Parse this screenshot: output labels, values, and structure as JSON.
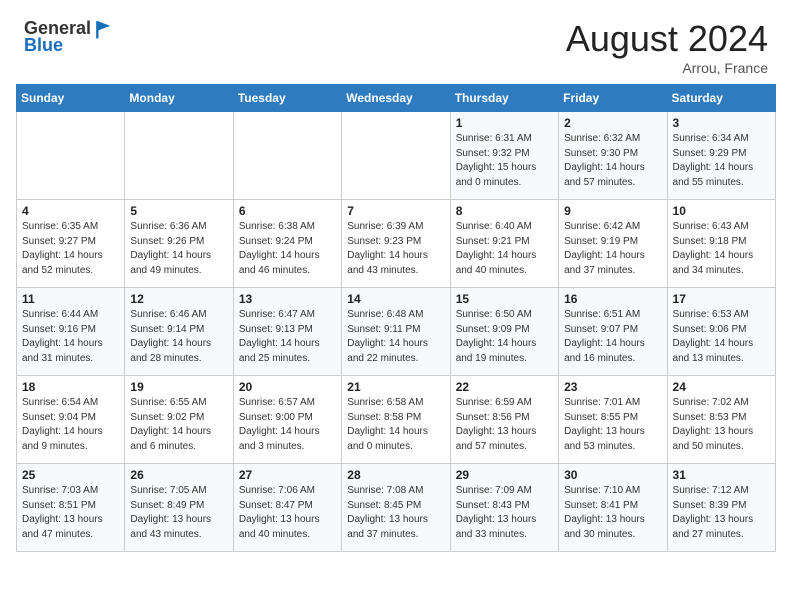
{
  "header": {
    "logo_line1": "General",
    "logo_line2": "Blue",
    "month_title": "August 2024",
    "location": "Arrou, France"
  },
  "days_of_week": [
    "Sunday",
    "Monday",
    "Tuesday",
    "Wednesday",
    "Thursday",
    "Friday",
    "Saturday"
  ],
  "weeks": [
    [
      {
        "day": "",
        "info": ""
      },
      {
        "day": "",
        "info": ""
      },
      {
        "day": "",
        "info": ""
      },
      {
        "day": "",
        "info": ""
      },
      {
        "day": "1",
        "info": "Sunrise: 6:31 AM\nSunset: 9:32 PM\nDaylight: 15 hours\nand 0 minutes."
      },
      {
        "day": "2",
        "info": "Sunrise: 6:32 AM\nSunset: 9:30 PM\nDaylight: 14 hours\nand 57 minutes."
      },
      {
        "day": "3",
        "info": "Sunrise: 6:34 AM\nSunset: 9:29 PM\nDaylight: 14 hours\nand 55 minutes."
      }
    ],
    [
      {
        "day": "4",
        "info": "Sunrise: 6:35 AM\nSunset: 9:27 PM\nDaylight: 14 hours\nand 52 minutes."
      },
      {
        "day": "5",
        "info": "Sunrise: 6:36 AM\nSunset: 9:26 PM\nDaylight: 14 hours\nand 49 minutes."
      },
      {
        "day": "6",
        "info": "Sunrise: 6:38 AM\nSunset: 9:24 PM\nDaylight: 14 hours\nand 46 minutes."
      },
      {
        "day": "7",
        "info": "Sunrise: 6:39 AM\nSunset: 9:23 PM\nDaylight: 14 hours\nand 43 minutes."
      },
      {
        "day": "8",
        "info": "Sunrise: 6:40 AM\nSunset: 9:21 PM\nDaylight: 14 hours\nand 40 minutes."
      },
      {
        "day": "9",
        "info": "Sunrise: 6:42 AM\nSunset: 9:19 PM\nDaylight: 14 hours\nand 37 minutes."
      },
      {
        "day": "10",
        "info": "Sunrise: 6:43 AM\nSunset: 9:18 PM\nDaylight: 14 hours\nand 34 minutes."
      }
    ],
    [
      {
        "day": "11",
        "info": "Sunrise: 6:44 AM\nSunset: 9:16 PM\nDaylight: 14 hours\nand 31 minutes."
      },
      {
        "day": "12",
        "info": "Sunrise: 6:46 AM\nSunset: 9:14 PM\nDaylight: 14 hours\nand 28 minutes."
      },
      {
        "day": "13",
        "info": "Sunrise: 6:47 AM\nSunset: 9:13 PM\nDaylight: 14 hours\nand 25 minutes."
      },
      {
        "day": "14",
        "info": "Sunrise: 6:48 AM\nSunset: 9:11 PM\nDaylight: 14 hours\nand 22 minutes."
      },
      {
        "day": "15",
        "info": "Sunrise: 6:50 AM\nSunset: 9:09 PM\nDaylight: 14 hours\nand 19 minutes."
      },
      {
        "day": "16",
        "info": "Sunrise: 6:51 AM\nSunset: 9:07 PM\nDaylight: 14 hours\nand 16 minutes."
      },
      {
        "day": "17",
        "info": "Sunrise: 6:53 AM\nSunset: 9:06 PM\nDaylight: 14 hours\nand 13 minutes."
      }
    ],
    [
      {
        "day": "18",
        "info": "Sunrise: 6:54 AM\nSunset: 9:04 PM\nDaylight: 14 hours\nand 9 minutes."
      },
      {
        "day": "19",
        "info": "Sunrise: 6:55 AM\nSunset: 9:02 PM\nDaylight: 14 hours\nand 6 minutes."
      },
      {
        "day": "20",
        "info": "Sunrise: 6:57 AM\nSunset: 9:00 PM\nDaylight: 14 hours\nand 3 minutes."
      },
      {
        "day": "21",
        "info": "Sunrise: 6:58 AM\nSunset: 8:58 PM\nDaylight: 14 hours\nand 0 minutes."
      },
      {
        "day": "22",
        "info": "Sunrise: 6:59 AM\nSunset: 8:56 PM\nDaylight: 13 hours\nand 57 minutes."
      },
      {
        "day": "23",
        "info": "Sunrise: 7:01 AM\nSunset: 8:55 PM\nDaylight: 13 hours\nand 53 minutes."
      },
      {
        "day": "24",
        "info": "Sunrise: 7:02 AM\nSunset: 8:53 PM\nDaylight: 13 hours\nand 50 minutes."
      }
    ],
    [
      {
        "day": "25",
        "info": "Sunrise: 7:03 AM\nSunset: 8:51 PM\nDaylight: 13 hours\nand 47 minutes."
      },
      {
        "day": "26",
        "info": "Sunrise: 7:05 AM\nSunset: 8:49 PM\nDaylight: 13 hours\nand 43 minutes."
      },
      {
        "day": "27",
        "info": "Sunrise: 7:06 AM\nSunset: 8:47 PM\nDaylight: 13 hours\nand 40 minutes."
      },
      {
        "day": "28",
        "info": "Sunrise: 7:08 AM\nSunset: 8:45 PM\nDaylight: 13 hours\nand 37 minutes."
      },
      {
        "day": "29",
        "info": "Sunrise: 7:09 AM\nSunset: 8:43 PM\nDaylight: 13 hours\nand 33 minutes."
      },
      {
        "day": "30",
        "info": "Sunrise: 7:10 AM\nSunset: 8:41 PM\nDaylight: 13 hours\nand 30 minutes."
      },
      {
        "day": "31",
        "info": "Sunrise: 7:12 AM\nSunset: 8:39 PM\nDaylight: 13 hours\nand 27 minutes."
      }
    ]
  ]
}
